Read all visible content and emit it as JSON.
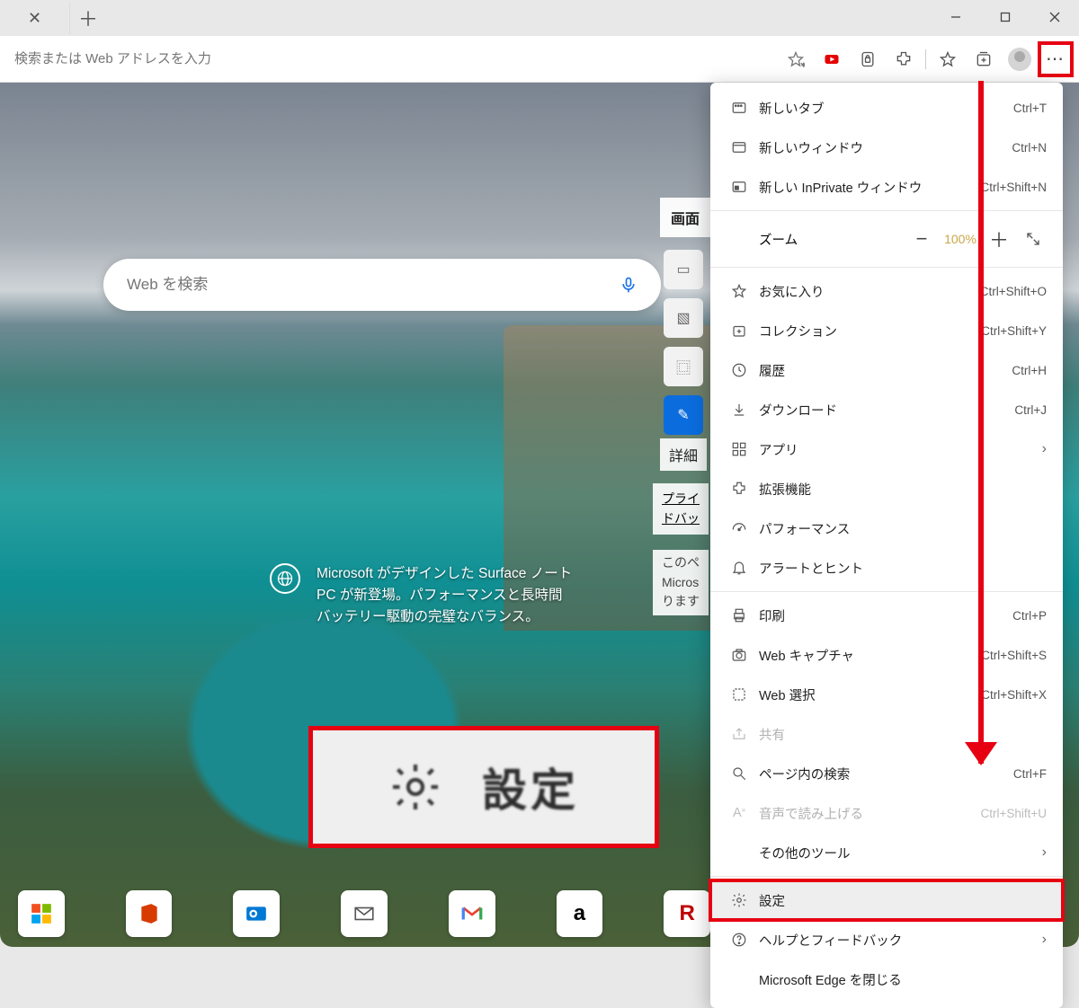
{
  "addressbar": {
    "placeholder": "検索または Web アドレスを入力"
  },
  "search": {
    "placeholder": "Web を検索"
  },
  "side": {
    "heading": "画面",
    "detail": "詳細",
    "privacy_line1": "プライ",
    "privacy_line2": "ドバッ",
    "hint_line1": "このペ",
    "hint_line2": "Micros",
    "hint_line3": "ります"
  },
  "promo": {
    "line1": "Microsoft がデザインした Surface ノート",
    "line2": "PC が新登場。パフォーマンスと長時間",
    "line3": "バッテリー駆動の完璧なバランス。"
  },
  "menu": {
    "new_tab": {
      "label": "新しいタブ",
      "shortcut": "Ctrl+T"
    },
    "new_window": {
      "label": "新しいウィンドウ",
      "shortcut": "Ctrl+N"
    },
    "new_inprivate": {
      "label": "新しい InPrivate ウィンドウ",
      "shortcut": "Ctrl+Shift+N"
    },
    "zoom": {
      "label": "ズーム",
      "value": "100%"
    },
    "favorites": {
      "label": "お気に入り",
      "shortcut": "Ctrl+Shift+O"
    },
    "collections": {
      "label": "コレクション",
      "shortcut": "Ctrl+Shift+Y"
    },
    "history": {
      "label": "履歴",
      "shortcut": "Ctrl+H"
    },
    "downloads": {
      "label": "ダウンロード",
      "shortcut": "Ctrl+J"
    },
    "apps": {
      "label": "アプリ"
    },
    "extensions": {
      "label": "拡張機能"
    },
    "performance": {
      "label": "パフォーマンス"
    },
    "alerts": {
      "label": "アラートとヒント"
    },
    "print": {
      "label": "印刷",
      "shortcut": "Ctrl+P"
    },
    "capture": {
      "label": "Web キャプチャ",
      "shortcut": "Ctrl+Shift+S"
    },
    "select": {
      "label": "Web 選択",
      "shortcut": "Ctrl+Shift+X"
    },
    "share": {
      "label": "共有"
    },
    "find": {
      "label": "ページ内の検索",
      "shortcut": "Ctrl+F"
    },
    "read_aloud": {
      "label": "音声で読み上げる",
      "shortcut": "Ctrl+Shift+U"
    },
    "more_tools": {
      "label": "その他のツール"
    },
    "settings": {
      "label": "設定"
    },
    "help": {
      "label": "ヘルプとフィードバック"
    },
    "close_edge": {
      "label": "Microsoft Edge を閉じる"
    }
  },
  "callout": {
    "label": "設定"
  },
  "quicklinks": [
    "microsoft",
    "office",
    "outlook",
    "yahoo-mail",
    "gmail",
    "amazon",
    "rakuten"
  ]
}
